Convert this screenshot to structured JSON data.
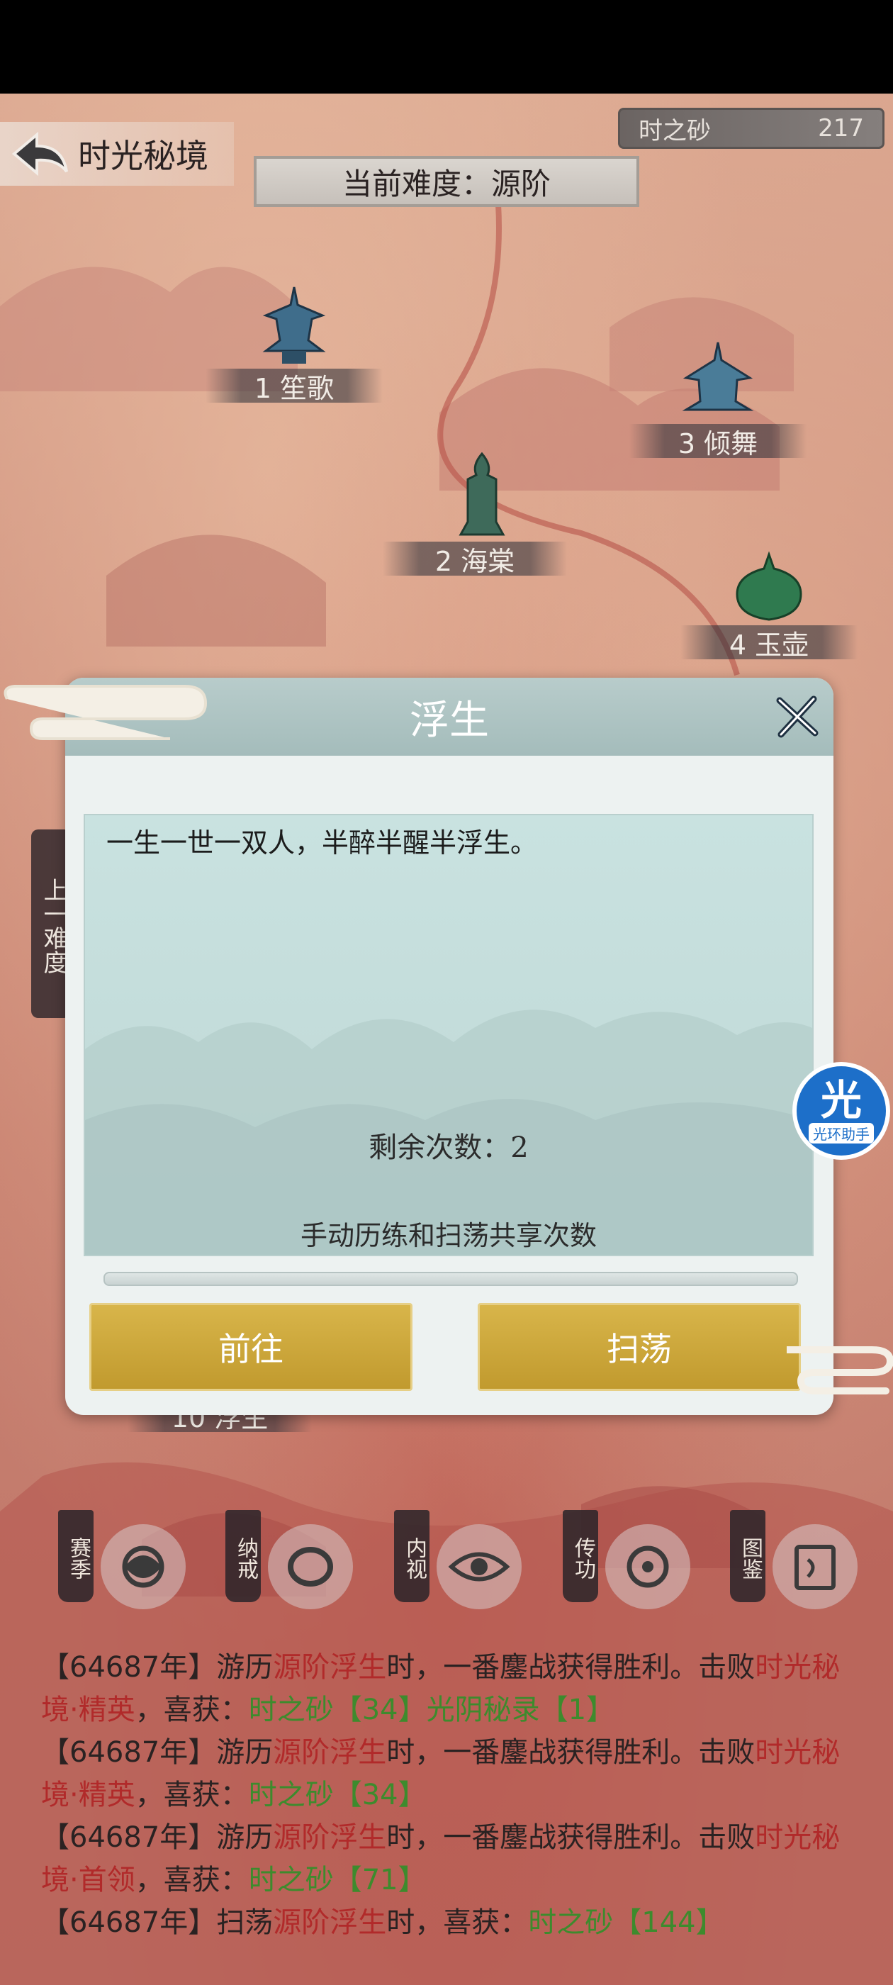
{
  "header": {
    "title": "时光秘境",
    "resource_name": "时之砂",
    "resource_value": "217",
    "difficulty": "当前难度：源阶"
  },
  "map_nodes": [
    {
      "label": "1 笙歌"
    },
    {
      "label": "3 倾舞"
    },
    {
      "label": "2 海棠"
    },
    {
      "label": "4 玉壶"
    },
    {
      "label": "10 浮生"
    }
  ],
  "side_tab": {
    "label": "上一难度"
  },
  "dialog": {
    "title": "浮生",
    "description": "一生一世一双人，半醉半醒半浮生。",
    "remaining": "剩余次数：2",
    "note": "手动历练和扫荡共享次数",
    "go_label": "前往",
    "sweep_label": "扫荡"
  },
  "helper": {
    "main": "光",
    "sub": "光环助手"
  },
  "bottom_icons": [
    {
      "tag": "赛季",
      "icon": "season-icon"
    },
    {
      "tag": "纳戒",
      "icon": "ring-icon"
    },
    {
      "tag": "内视",
      "icon": "eye-icon"
    },
    {
      "tag": "传功",
      "icon": "transfer-icon"
    },
    {
      "tag": "图鉴",
      "icon": "atlas-icon"
    }
  ],
  "log": [
    {
      "prefix": "【64687年】游历",
      "place": "源阶浮生",
      "mid": "时，一番鏖战获得胜利。击败",
      "enemy": "时光秘境·精英",
      "gain": "，喜获：",
      "rewards": "时之砂【34】光阴秘录【1】"
    },
    {
      "prefix": "【64687年】游历",
      "place": "源阶浮生",
      "mid": "时，一番鏖战获得胜利。击败",
      "enemy": "时光秘境·精英",
      "gain": "，喜获：",
      "rewards": "时之砂【34】"
    },
    {
      "prefix": "【64687年】游历",
      "place": "源阶浮生",
      "mid": "时，一番鏖战获得胜利。击败",
      "enemy": "时光秘境·首领",
      "gain": "，喜获：",
      "rewards": "时之砂【71】"
    },
    {
      "prefix": "【64687年】扫荡",
      "place": "源阶浮生",
      "mid": "时，喜获：",
      "rewards": "时之砂【144】"
    }
  ],
  "colors": {
    "accent_gold": "#c9a43a",
    "log_highlight": "#b12a2a",
    "log_reward": "#3d8b2d",
    "dialog_head": "#a9c0bf"
  }
}
